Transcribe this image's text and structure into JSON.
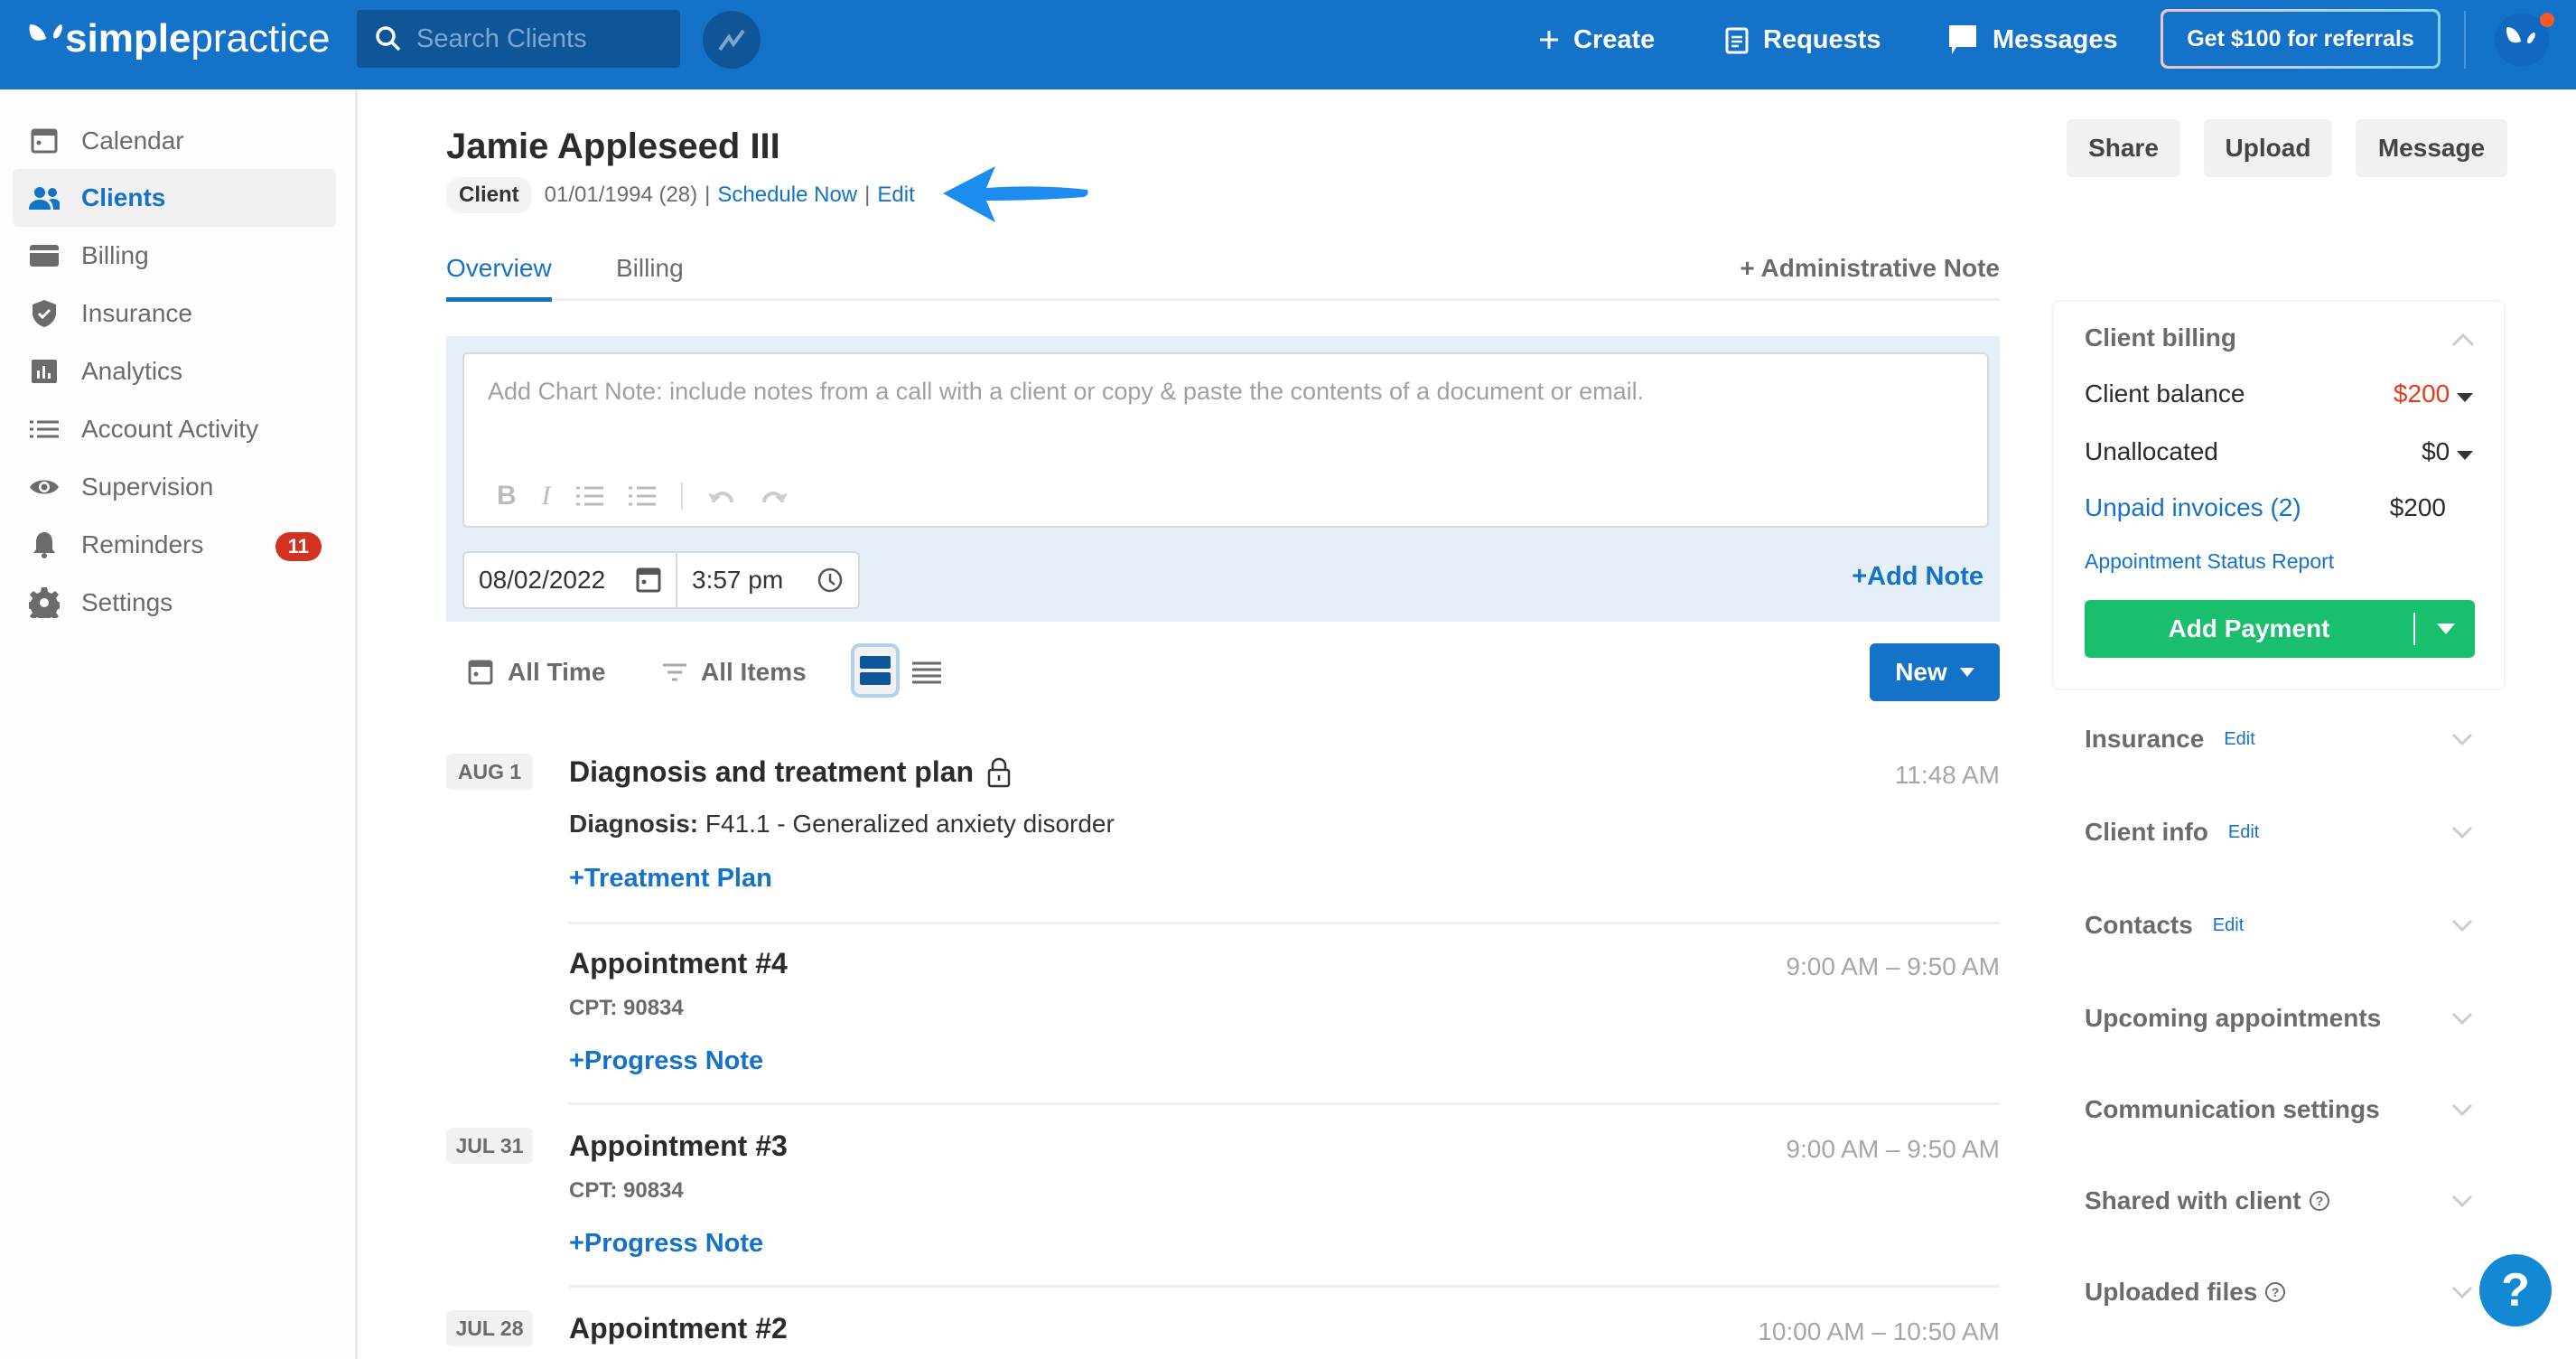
{
  "header": {
    "logo_bold": "simple",
    "logo_light": "practice",
    "search_placeholder": "Search Clients",
    "create_label": "Create",
    "requests_label": "Requests",
    "messages_label": "Messages",
    "referral_label": "Get $100 for referrals"
  },
  "sidebar": {
    "items": [
      {
        "label": "Calendar",
        "icon": "calendar-icon"
      },
      {
        "label": "Clients",
        "icon": "users-icon",
        "active": true
      },
      {
        "label": "Billing",
        "icon": "credit-card-icon"
      },
      {
        "label": "Insurance",
        "icon": "shield-icon"
      },
      {
        "label": "Analytics",
        "icon": "bar-chart-icon"
      },
      {
        "label": "Account Activity",
        "icon": "list-icon"
      },
      {
        "label": "Supervision",
        "icon": "eye-icon"
      },
      {
        "label": "Reminders",
        "icon": "bell-icon",
        "badge": "11"
      },
      {
        "label": "Settings",
        "icon": "gear-icon"
      }
    ]
  },
  "client": {
    "name": "Jamie Appleseed III",
    "type_badge": "Client",
    "dob_age": "01/01/1994 (28)",
    "separator": "|",
    "schedule_link": "Schedule Now",
    "edit_link": "Edit"
  },
  "actions": {
    "share": "Share",
    "upload": "Upload",
    "message": "Message"
  },
  "tabs": {
    "overview": "Overview",
    "billing": "Billing",
    "admin_note": "+ Administrative Note"
  },
  "chart_note": {
    "placeholder": "Add Chart Note: include notes from a call with a client or copy & paste the contents of a document or email.",
    "date": "08/02/2022",
    "time": "3:57 pm",
    "add_note": "+Add Note",
    "toolbar": {
      "bold": "B",
      "italic": "I"
    }
  },
  "filters": {
    "time": "All Time",
    "items": "All Items",
    "new_button": "New"
  },
  "timeline": [
    {
      "date": "AUG 1",
      "title": "Diagnosis and treatment plan",
      "locked": true,
      "time": "11:48 AM",
      "desc_label": "Diagnosis:",
      "desc": "F41.1 - Generalized anxiety disorder",
      "action": "+Treatment Plan"
    },
    {
      "date": "",
      "title": "Appointment #4",
      "time": "9:00 AM – 9:50 AM",
      "cpt": "CPT: 90834",
      "action": "+Progress Note"
    },
    {
      "date": "JUL 31",
      "title": "Appointment #3",
      "time": "9:00 AM – 9:50 AM",
      "cpt": "CPT: 90834",
      "action": "+Progress Note"
    },
    {
      "date": "JUL 28",
      "title": "Appointment #2",
      "time": "10:00 AM – 10:50 AM"
    }
  ],
  "billing_card": {
    "title": "Client billing",
    "client_balance_label": "Client balance",
    "client_balance_value": "$200",
    "unallocated_label": "Unallocated",
    "unallocated_value": "$0",
    "unpaid_label": "Unpaid invoices (2)",
    "unpaid_value": "$200",
    "report_link": "Appointment Status Report",
    "add_payment": "Add Payment",
    "balance_color": "#e8391e"
  },
  "right_sections": [
    {
      "label": "Insurance",
      "edit": "Edit"
    },
    {
      "label": "Client info",
      "edit": "Edit"
    },
    {
      "label": "Contacts",
      "edit": "Edit"
    },
    {
      "label": "Upcoming appointments"
    },
    {
      "label": "Communication settings"
    },
    {
      "label": "Shared with client",
      "help": true
    },
    {
      "label": "Uploaded files",
      "help": true
    }
  ],
  "help_button": "?"
}
